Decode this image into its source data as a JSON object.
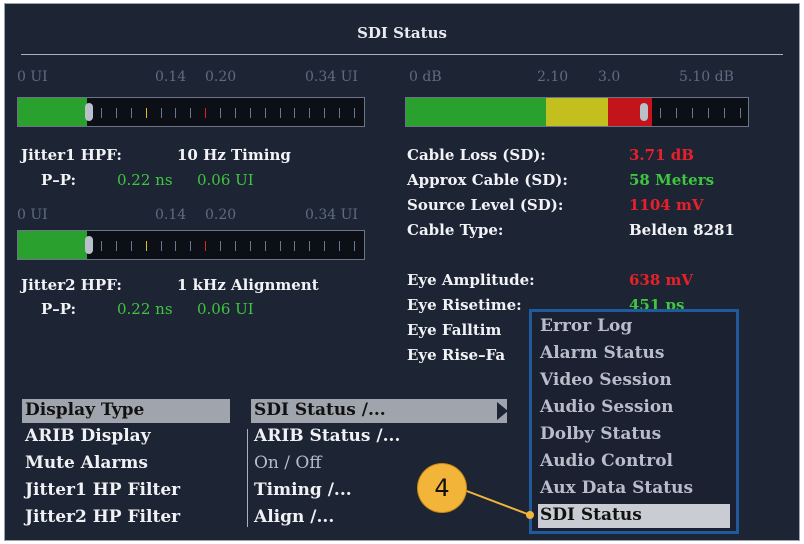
{
  "window": {
    "title": "SDI Status"
  },
  "jitter1": {
    "scale": [
      "0 UI",
      "0.14",
      "0.20",
      "0.34 UI"
    ],
    "hpf_label": "Jitter1 HPF:",
    "hpf_value": "10 Hz Timing",
    "pp_label": "P–P:",
    "pp_ns": "0.22 ns",
    "pp_ui": "0.06 UI",
    "level": 0.2
  },
  "jitter2": {
    "scale": [
      "0 UI",
      "0.14",
      "0.20",
      "0.34 UI"
    ],
    "hpf_label": "Jitter2 HPF:",
    "hpf_value": "1 kHz Alignment",
    "pp_label": "P–P:",
    "pp_ns": "0.22 ns",
    "pp_ui": "0.06 UI",
    "level": 0.2
  },
  "cable": {
    "scale": [
      "0 dB",
      "2.10",
      "3.0",
      "5.10 dB"
    ],
    "rows": [
      {
        "label": "Cable Loss (SD):",
        "value": "3.71 dB",
        "color": "red"
      },
      {
        "label": "Approx Cable (SD):",
        "value": "58 Meters",
        "color": "green"
      },
      {
        "label": "Source Level (SD):",
        "value": "1104 mV",
        "color": "red"
      },
      {
        "label": "Cable Type:",
        "value": "Belden 8281",
        "color": "white"
      }
    ],
    "level": 0.72
  },
  "eye": {
    "rows": [
      {
        "label": "Eye Amplitude:",
        "value": "638 mV",
        "color": "red"
      },
      {
        "label": "Eye Risetime:",
        "value": "451 ps",
        "color": "green"
      },
      {
        "label": "Eye Falltim",
        "value": ""
      },
      {
        "label": "Eye Rise–Fa",
        "value": ""
      }
    ]
  },
  "menu": {
    "left": [
      "Display Type",
      "ARIB Display",
      "Mute Alarms",
      "Jitter1 HP Filter",
      "Jitter2 HP Filter"
    ],
    "right": [
      "SDI Status /...",
      "ARIB Status /...",
      "On / Off",
      "Timing /...",
      "Align /..."
    ]
  },
  "popup": {
    "items": [
      "Error Log",
      "Alarm Status",
      "Video Session",
      "Audio Session",
      "Dolby Status",
      "Audio Control",
      "Aux Data Status",
      "SDI Status"
    ],
    "selected": "SDI Status"
  },
  "callout": {
    "number": "4"
  },
  "colors": {
    "green": "#2aa12e",
    "yellow": "#c2bf1e",
    "red": "#c2141a",
    "accent_blue": "#1f5a9c",
    "callout": "#f3b43a"
  }
}
